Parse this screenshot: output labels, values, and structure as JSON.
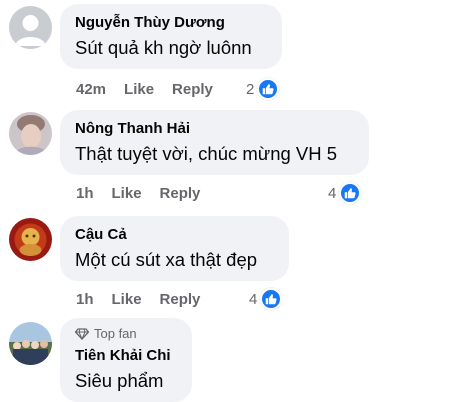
{
  "comments": [
    {
      "author": "Nguyễn Thùy Dương",
      "text": "Sút quả kh ngờ luônn",
      "time": "42m",
      "like_label": "Like",
      "reply_label": "Reply",
      "reaction_count": "2",
      "reaction_icon": "thumbs-up-icon",
      "avatar": "default-avatar-icon"
    },
    {
      "author": "Nông Thanh Hải",
      "text": "Thật tuyệt vời, chúc mừng VH 5",
      "time": "1h",
      "like_label": "Like",
      "reply_label": "Reply",
      "reaction_count": "4",
      "reaction_icon": "thumbs-up-icon",
      "avatar": "profile-photo"
    },
    {
      "author": "Cậu Cả",
      "text": "Một cú sút xa thật đẹp",
      "time": "1h",
      "like_label": "Like",
      "reply_label": "Reply",
      "reaction_count": "4",
      "reaction_icon": "thumbs-up-icon",
      "avatar": "profile-photo"
    },
    {
      "badge": "Top fan",
      "badge_icon": "diamond-icon",
      "author": "Tiên Khải Chi",
      "text": "Siêu phẩm",
      "avatar": "profile-photo"
    }
  ],
  "colors": {
    "bubble": "#f0f2f5",
    "secondary_text": "#65676b",
    "like_blue": "#1877f2"
  }
}
